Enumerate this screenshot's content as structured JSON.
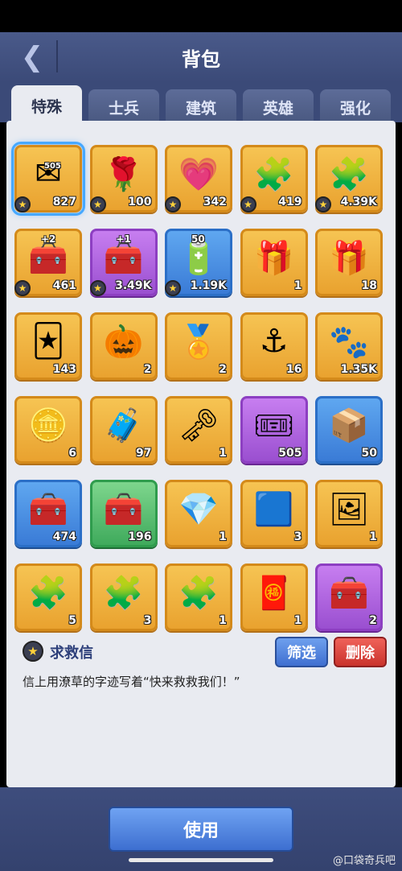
{
  "header": {
    "title": "背包",
    "back_icon": "chevron-left-icon"
  },
  "tabs": [
    {
      "label": "特殊",
      "active": true
    },
    {
      "label": "士兵",
      "active": false
    },
    {
      "label": "建筑",
      "active": false
    },
    {
      "label": "英雄",
      "active": false
    },
    {
      "label": "强化",
      "active": false
    }
  ],
  "items": [
    {
      "name": "rescue-letter",
      "icon": "✉",
      "count": "827",
      "star": true,
      "rarity": "gold",
      "selected": true,
      "badge": "505"
    },
    {
      "name": "white-rose",
      "icon": "🌹",
      "count": "100",
      "star": true,
      "rarity": "gold"
    },
    {
      "name": "pink-heart",
      "icon": "💗",
      "count": "342",
      "star": true,
      "rarity": "gold"
    },
    {
      "name": "puzzle-paint",
      "icon": "🧩",
      "count": "419",
      "star": true,
      "rarity": "gold"
    },
    {
      "name": "puzzle-fire",
      "icon": "🧩",
      "count": "4.39K",
      "star": true,
      "rarity": "gold"
    },
    {
      "name": "green-chest-plus2",
      "icon": "🧰",
      "count": "461",
      "star": true,
      "rarity": "gold",
      "plus": "+2"
    },
    {
      "name": "green-chest-plus1",
      "icon": "🧰",
      "count": "3.49K",
      "star": true,
      "rarity": "purple",
      "plus": "+1"
    },
    {
      "name": "battery-50",
      "icon": "🔋",
      "count": "1.19K",
      "star": true,
      "rarity": "blue",
      "plus": "50"
    },
    {
      "name": "purple-gift",
      "icon": "🎁",
      "count": "1",
      "star": false,
      "rarity": "gold"
    },
    {
      "name": "blue-gift",
      "icon": "🎁",
      "count": "18",
      "star": false,
      "rarity": "gold"
    },
    {
      "name": "monster-card",
      "icon": "🃏",
      "count": "143",
      "star": false,
      "rarity": "gold"
    },
    {
      "name": "pumpkin-key",
      "icon": "🎃",
      "count": "2",
      "star": false,
      "rarity": "gold"
    },
    {
      "name": "gem-medal",
      "icon": "🏅",
      "count": "2",
      "star": false,
      "rarity": "gold"
    },
    {
      "name": "anchor-coin",
      "icon": "⚓",
      "count": "16",
      "star": false,
      "rarity": "gold"
    },
    {
      "name": "paw-coin",
      "icon": "🐾",
      "count": "1.35K",
      "star": false,
      "rarity": "gold"
    },
    {
      "name": "silver-coin",
      "icon": "🪙",
      "count": "6",
      "star": false,
      "rarity": "gold"
    },
    {
      "name": "gold-chest",
      "icon": "🧳",
      "count": "97",
      "star": false,
      "rarity": "gold"
    },
    {
      "name": "heart-key",
      "icon": "🗝",
      "count": "1",
      "star": false,
      "rarity": "gold"
    },
    {
      "name": "ticket-voucher",
      "icon": "🎟",
      "count": "505",
      "star": false,
      "rarity": "purple"
    },
    {
      "name": "green-crate",
      "icon": "📦",
      "count": "50",
      "star": false,
      "rarity": "blue"
    },
    {
      "name": "purple-chest",
      "icon": "🧰",
      "count": "474",
      "star": false,
      "rarity": "blue"
    },
    {
      "name": "steel-chest",
      "icon": "🧰",
      "count": "196",
      "star": false,
      "rarity": "green"
    },
    {
      "name": "crystal-crate",
      "icon": "💎",
      "count": "1",
      "star": false,
      "rarity": "gold"
    },
    {
      "name": "blueprint-tile",
      "icon": "🟦",
      "count": "3",
      "star": false,
      "rarity": "gold"
    },
    {
      "name": "party-frame",
      "icon": "🖼",
      "count": "1",
      "star": false,
      "rarity": "gold"
    },
    {
      "name": "silver-puzzle",
      "icon": "🧩",
      "count": "5",
      "star": false,
      "rarity": "gold"
    },
    {
      "name": "gold-puzzle-coin",
      "icon": "🧩",
      "count": "3",
      "star": false,
      "rarity": "gold"
    },
    {
      "name": "gold-puzzle",
      "icon": "🧩",
      "count": "1",
      "star": false,
      "rarity": "gold"
    },
    {
      "name": "red-charm",
      "icon": "🧧",
      "count": "1",
      "star": false,
      "rarity": "gold"
    },
    {
      "name": "purple-crate",
      "icon": "🧰",
      "count": "2",
      "star": false,
      "rarity": "purple"
    }
  ],
  "detail": {
    "name": "求救信",
    "description": "信上用潦草的字迹写着“快来救救我们！”",
    "filter_label": "筛选",
    "delete_label": "删除"
  },
  "footer": {
    "use_label": "使用"
  },
  "watermark": "@口袋奇兵吧",
  "colors": {
    "header": "#3b4a78",
    "panel": "#e9ebf1",
    "gold": "#e9a22f",
    "purple": "#9a4fd0",
    "blue": "#3a7bd6",
    "green": "#3faa5c"
  }
}
